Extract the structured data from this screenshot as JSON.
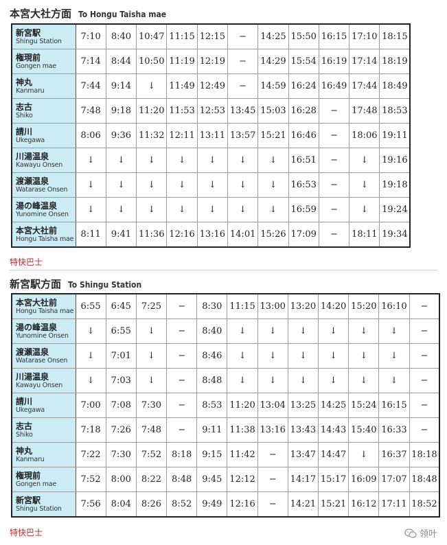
{
  "section1": {
    "title_jp": "本宮大社方面",
    "title_en": "To Hongu Taisha mae",
    "legend": "特快巴士",
    "rows": [
      {
        "jp": "新宮駅",
        "en": "Shingu Station",
        "times": [
          "7:10",
          "8:40",
          "10:47",
          "11:15",
          "12:15",
          "−",
          "14:25",
          "15:50",
          "16:15",
          "17:10",
          "18:15"
        ],
        "red": [
          2
        ]
      },
      {
        "jp": "権現前",
        "en": "Gongen mae",
        "times": [
          "7:14",
          "8:44",
          "10:50",
          "11:19",
          "12:19",
          "−",
          "14:29",
          "15:54",
          "16:19",
          "17:14",
          "18:19"
        ],
        "red": [
          2
        ]
      },
      {
        "jp": "神丸",
        "en": "Kanmaru",
        "times": [
          "7:44",
          "9:14",
          "↓",
          "11:49",
          "12:49",
          "−",
          "14:59",
          "16:24",
          "16:49",
          "17:44",
          "18:49"
        ],
        "red": [
          2
        ]
      },
      {
        "jp": "志古",
        "en": "Shiko",
        "times": [
          "7:48",
          "9:18",
          "11:20",
          "11:53",
          "12:53",
          "13:45",
          "15:03",
          "16:28",
          "−",
          "17:48",
          "18:53"
        ],
        "red": [
          2,
          5
        ]
      },
      {
        "jp": "請川",
        "en": "Ukegawa",
        "times": [
          "8:06",
          "9:36",
          "11:32",
          "12:11",
          "13:11",
          "13:57",
          "15:21",
          "16:46",
          "−",
          "18:06",
          "19:11"
        ],
        "red": [
          2,
          5
        ]
      },
      {
        "jp": "川湯温泉",
        "en": "Kawayu Onsen",
        "times": [
          "↓",
          "↓",
          "↓",
          "↓",
          "↓",
          "↓",
          "↓",
          "16:51",
          "−",
          "↓",
          "19:16"
        ],
        "red": [
          2,
          5
        ]
      },
      {
        "jp": "渡瀬温泉",
        "en": "Watarase Onsen",
        "times": [
          "↓",
          "↓",
          "↓",
          "↓",
          "↓",
          "↓",
          "↓",
          "16:53",
          "−",
          "↓",
          "19:18"
        ],
        "red": [
          2,
          5
        ]
      },
      {
        "jp": "湯の峰温泉",
        "en": "Yunomine Onsen",
        "times": [
          "↓",
          "↓",
          "↓",
          "↓",
          "↓",
          "↓",
          "↓",
          "16:59",
          "−",
          "↓",
          "19:24"
        ],
        "red": [
          2,
          5
        ]
      },
      {
        "jp": "本宮大社前",
        "en": "Hongu Taisha mae",
        "times": [
          "8:11",
          "9:41",
          "11:36",
          "12:16",
          "13:16",
          "14:01",
          "15:26",
          "17:09",
          "−",
          "18:11",
          "19:34"
        ],
        "red": [
          2,
          5
        ]
      }
    ]
  },
  "section2": {
    "title_jp": "新宮駅方面",
    "title_en": "To Shingu Station",
    "legend": "特快巴士",
    "rows": [
      {
        "jp": "本宮大社前",
        "en": "Hongu Taisha mae",
        "times": [
          "6:55",
          "6:45",
          "7:25",
          "−",
          "8:30",
          "11:15",
          "13:00",
          "13:20",
          "14:20",
          "15:20",
          "16:10",
          "−"
        ],
        "red": [
          6,
          9
        ]
      },
      {
        "jp": "湯の峰温泉",
        "en": "Yunomine Onsen",
        "times": [
          "↓",
          "6:55",
          "↓",
          "−",
          "8:40",
          "↓",
          "↓",
          "↓",
          "↓",
          "↓",
          "↓",
          "−"
        ],
        "red": [
          6,
          9
        ]
      },
      {
        "jp": "渡瀬温泉",
        "en": "Watarase Onsen",
        "times": [
          "↓",
          "7:01",
          "↓",
          "−",
          "8:46",
          "↓",
          "↓",
          "↓",
          "↓",
          "↓",
          "↓",
          "−"
        ],
        "red": [
          6,
          9
        ]
      },
      {
        "jp": "川湯温泉",
        "en": "Kawayu Onsen",
        "times": [
          "↓",
          "7:03",
          "↓",
          "−",
          "8:48",
          "↓",
          "↓",
          "↓",
          "↓",
          "↓",
          "↓",
          "−"
        ],
        "red": [
          6,
          9
        ]
      },
      {
        "jp": "請川",
        "en": "Ukegawa",
        "times": [
          "7:00",
          "7:08",
          "7:30",
          "−",
          "8:53",
          "11:20",
          "13:04",
          "13:25",
          "14:25",
          "15:24",
          "16:15",
          "−"
        ],
        "red": [
          6,
          9
        ]
      },
      {
        "jp": "志古",
        "en": "Shiko",
        "times": [
          "7:18",
          "7:26",
          "7:48",
          "−",
          "9:11",
          "11:38",
          "13:16",
          "13:43",
          "14:43",
          "15:40",
          "16:33",
          "−"
        ],
        "red": [
          6,
          9
        ]
      },
      {
        "jp": "神丸",
        "en": "Kanmaru",
        "times": [
          "7:22",
          "7:30",
          "7:52",
          "8:18",
          "9:15",
          "11:42",
          "−",
          "13:47",
          "14:47",
          "↓",
          "16:37",
          "18:18"
        ],
        "red": [
          6,
          9
        ]
      },
      {
        "jp": "権現前",
        "en": "Gongen mae",
        "times": [
          "7:52",
          "8:00",
          "8:22",
          "8:48",
          "9:45",
          "12:12",
          "−",
          "14:17",
          "15:17",
          "16:09",
          "17:07",
          "18:48"
        ],
        "red": [
          6,
          9
        ]
      },
      {
        "jp": "新宮駅",
        "en": "Shingu Station",
        "times": [
          "7:56",
          "8:04",
          "8:26",
          "8:52",
          "9:49",
          "12:16",
          "−",
          "14:21",
          "15:21",
          "16:12",
          "17:11",
          "18:52"
        ],
        "red": [
          6,
          9
        ]
      }
    ]
  },
  "watermark": "领叶",
  "colors": {
    "accent_red": "#c0282d",
    "stop_bg": "#ccecf5",
    "border": "#222222"
  }
}
